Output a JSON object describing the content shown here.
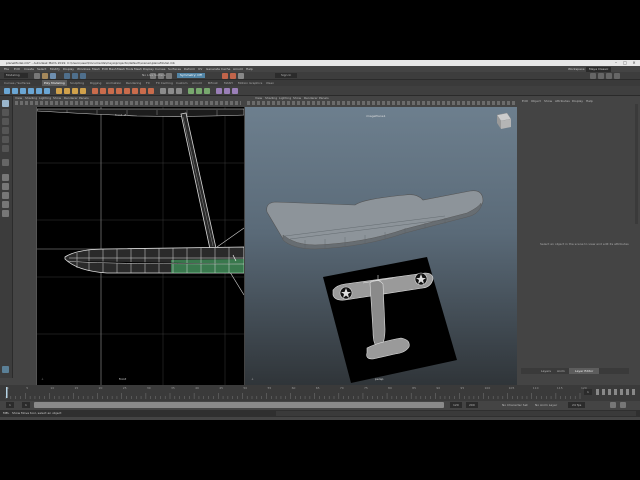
{
  "window": {
    "title": "planeModel.mb* - Autodesk MAYA 2019: C:\\Users\\user\\Documents\\maya\\projects\\default\\scenes\\planeModel.mb"
  },
  "menubar": {
    "items": [
      "File",
      "Edit",
      "Create",
      "Select",
      "Modify",
      "Display",
      "Windows",
      "Mesh",
      "Edit Mesh",
      "Mesh Tools",
      "Mesh Display",
      "Curves",
      "Surfaces",
      "Deform",
      "UV",
      "Generate",
      "Cache",
      "Arnold",
      "Help"
    ],
    "workspace_label": "Workspace:",
    "workspace_value": "Maya Classic"
  },
  "statusline": {
    "mode": "Modeling",
    "live_surface": "No Live Surface",
    "symmetry": "Symmetry: Off",
    "sign_in": "Sign In"
  },
  "shelf": {
    "tabs": [
      "Curves / Surfaces",
      "Poly Modeling",
      "Sculpting",
      "Rigging",
      "Animation",
      "Rendering",
      "FX",
      "FX Caching",
      "Custom",
      "Arnold",
      "Bifrost",
      "MASH",
      "Motion Graphics",
      "XGen"
    ]
  },
  "left_viewport": {
    "menus": [
      "View",
      "Shading",
      "Lighting",
      "Show",
      "Renderer",
      "Panels"
    ],
    "camera_label": "front",
    "camera_name": "front -Z"
  },
  "right_viewport": {
    "menus": [
      "View",
      "Shading",
      "Lighting",
      "Show",
      "Renderer",
      "Panels"
    ],
    "camera_name": "persp",
    "image_plane_name": "imagePlane1"
  },
  "channel_box": {
    "tabs": [
      "Edit",
      "Object",
      "Show",
      "Attributes",
      "Display",
      "Help"
    ],
    "empty_message": "Select an object in the scene to view and edit its attributes",
    "bottom_tabs": [
      "Layers",
      "Anim",
      "Layer Editor"
    ]
  },
  "timeline": {
    "ticks": [
      "1",
      "5",
      "10",
      "15",
      "20",
      "25",
      "30",
      "35",
      "40",
      "45",
      "50",
      "55",
      "60",
      "65",
      "70",
      "75",
      "80",
      "85",
      "90",
      "95",
      "100",
      "105",
      "110",
      "115",
      "120"
    ],
    "current_frame": "1"
  },
  "range": {
    "start": "1",
    "range_start": "1",
    "range_end": "120",
    "end": "200",
    "character_set": "No Character Set",
    "anim_layer": "No Anim Layer",
    "fps": "24 fps"
  },
  "helpline": {
    "mel_label": "MEL",
    "message": "Show Move tool, select an object"
  },
  "colors": {
    "app_bg": "#444444",
    "viewport_ortho_bg": "#000000",
    "viewport_persp_top": "#6d7f8e",
    "viewport_persp_bottom": "#2f3438",
    "selection_green": "#46b86a",
    "accent_blue": "#5285a6"
  },
  "icons": [
    "select-tool-icon",
    "lasso-tool-icon",
    "paint-select-icon",
    "move-tool-icon",
    "rotate-tool-icon",
    "scale-tool-icon",
    "minimize-icon",
    "maximize-icon",
    "close-icon",
    "snap-grid-icon",
    "snap-curve-icon",
    "snap-point-icon",
    "render-icon",
    "gear-icon"
  ]
}
